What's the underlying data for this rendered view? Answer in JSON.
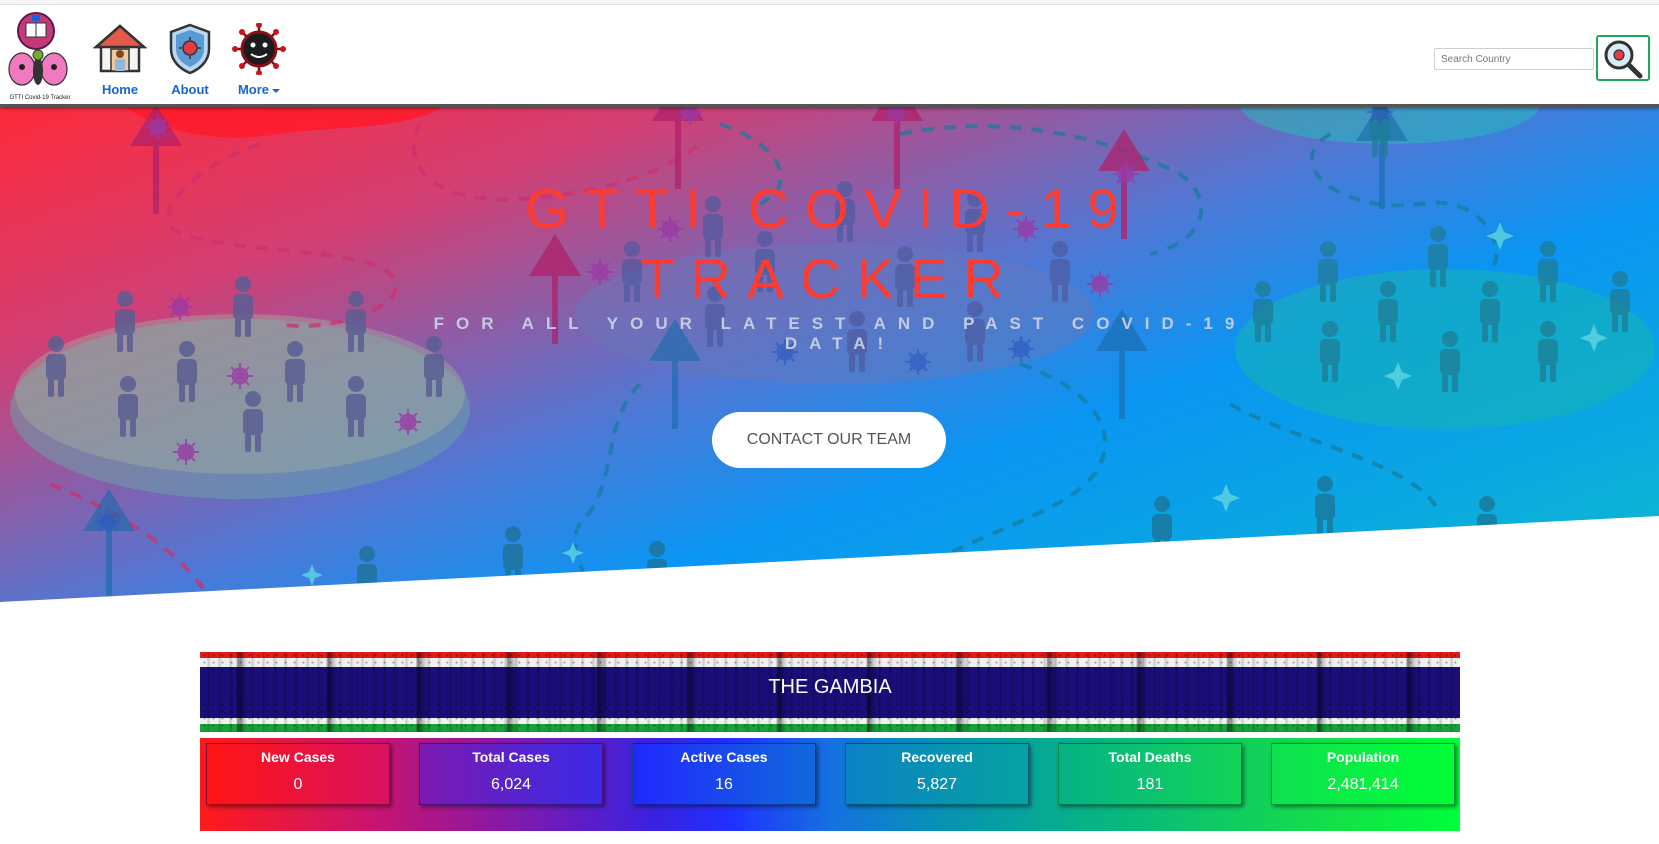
{
  "navbar": {
    "logo_text": "GTTI Covid-19 Tracker",
    "items": [
      {
        "label": "Home",
        "icon": "home-icon"
      },
      {
        "label": "About",
        "icon": "shield-virus-icon"
      },
      {
        "label": "More",
        "icon": "covid-virus-icon"
      }
    ],
    "search": {
      "placeholder": "Search Country",
      "value": "",
      "button_icon": "magnifier-virus-icon"
    }
  },
  "hero": {
    "title": "GTTI COVID-19 TRACKER",
    "subtitle": "FOR ALL YOUR LATEST AND PAST COVID-19 DATA!",
    "cta_label": "CONTACT OUR TEAM"
  },
  "country": {
    "name": "THE GAMBIA",
    "flag_colors": [
      "#e21b1b",
      "#f0f0f0",
      "#1a0e7a",
      "#f0f0f0",
      "#17a33a"
    ]
  },
  "stats": [
    {
      "title": "New Cases",
      "value": "0"
    },
    {
      "title": "Total Cases",
      "value": "6,024"
    },
    {
      "title": "Active Cases",
      "value": "16"
    },
    {
      "title": "Recovered",
      "value": "5,827"
    },
    {
      "title": "Total Deaths",
      "value": "181"
    },
    {
      "title": "Population",
      "value": "2,481,414"
    }
  ],
  "colors": {
    "nav_link": "#1565d8",
    "hero_title": "#ff3b2f",
    "search_border": "#22a45d"
  }
}
